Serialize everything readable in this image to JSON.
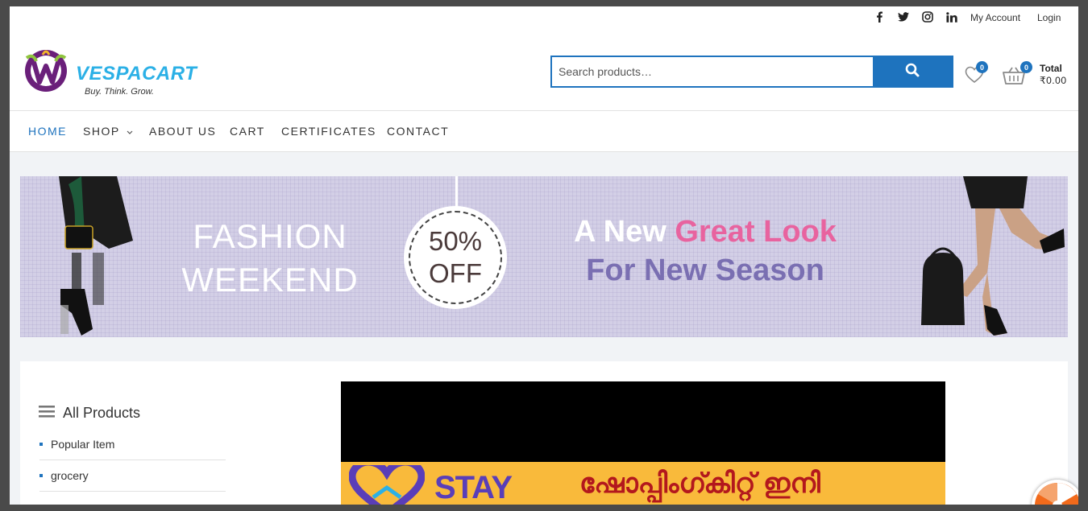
{
  "topbar": {
    "social": [
      "facebook-icon",
      "twitter-icon",
      "instagram-icon",
      "linkedin-icon"
    ],
    "my_account": "My Account",
    "login": "Login"
  },
  "header": {
    "logo_text": "VESPACART",
    "logo_tagline": "Buy. Think. Grow.",
    "search_placeholder": "Search products…",
    "wishlist_count": "0",
    "cart_count": "0",
    "total_label": "Total",
    "total_value": "₹0.00"
  },
  "nav": {
    "items": [
      "HOME",
      "SHOP",
      "ABOUT US",
      "CART",
      "CERTIFICATES",
      "CONTACT"
    ],
    "active": "HOME"
  },
  "banner": {
    "fashion_line1": "FASHION",
    "fashion_line2": "WEEKEND",
    "off_line1": "50%",
    "off_line2": "OFF",
    "headline_a": "A New ",
    "headline_b": "Great Look",
    "headline_c": "For New Season"
  },
  "sidebar": {
    "title": "All Products",
    "items": [
      "Popular Item",
      "grocery"
    ]
  },
  "promo": {
    "stay": "STAY",
    "malayalam": "ഷോപ്പിംഗ്കിറ്റ് ഇനി"
  },
  "colors": {
    "accent": "#1e73be",
    "pink": "#e8639f",
    "purple": "#7a6fb2",
    "banner_bg": "#d3cfe6"
  }
}
